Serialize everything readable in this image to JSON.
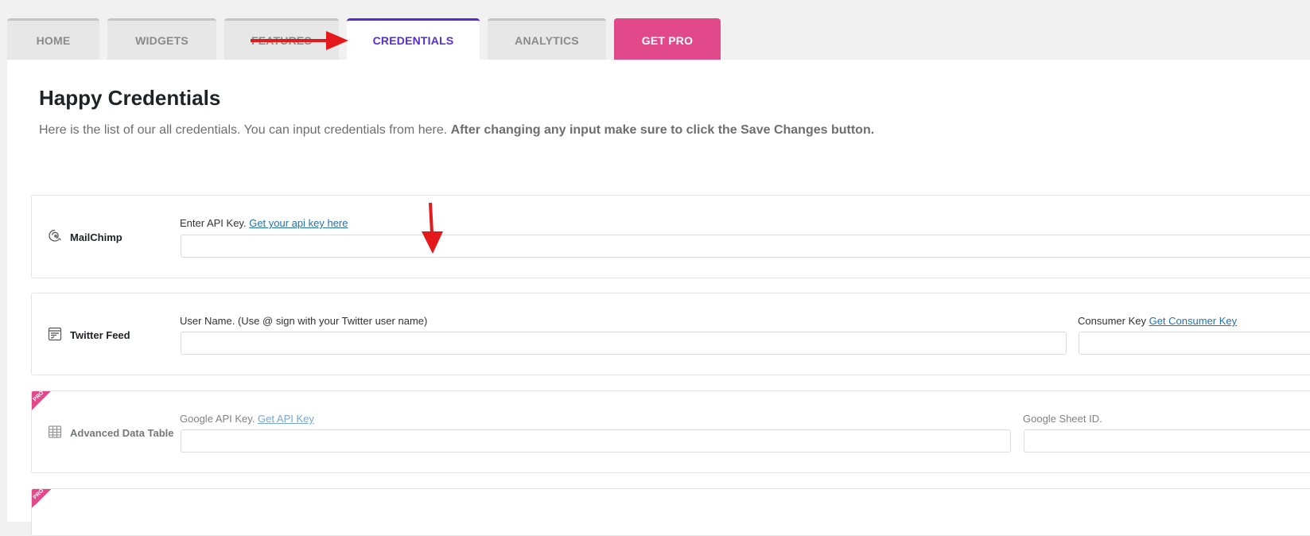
{
  "tabs": [
    {
      "label": "HOME"
    },
    {
      "label": "WIDGETS"
    },
    {
      "label": "FEATURES"
    },
    {
      "label": "CREDENTIALS",
      "active": true
    },
    {
      "label": "ANALYTICS"
    },
    {
      "label": "GET PRO"
    }
  ],
  "colors": {
    "accent": "#562dd4",
    "pro": "#e2498a",
    "link": "#2271b1",
    "annotation": "#e5191b"
  },
  "page": {
    "title": "Happy Credentials",
    "description": "Here is the list of our all credentials. You can input credentials from here. ",
    "description_bold": "After changing any input make sure to click the Save Changes button."
  },
  "credentials": [
    {
      "name": "MailChimp",
      "icon": "mailchimp-icon",
      "fields": [
        {
          "label": "Enter API Key. ",
          "link": "Get your api key here",
          "value": ""
        }
      ]
    },
    {
      "name": "Twitter Feed",
      "icon": "twitter-feed-icon",
      "fields": [
        {
          "label": "User Name. (Use @ sign with your Twitter user name)",
          "value": ""
        },
        {
          "label": "Consumer Key ",
          "link": "Get Consumer Key",
          "value": ""
        }
      ]
    },
    {
      "name": "Advanced Data Table",
      "icon": "data-table-icon",
      "pro_badge": "PRO",
      "fields": [
        {
          "label": "Google API Key. ",
          "link": "Get API Key",
          "value": ""
        },
        {
          "label": "Google Sheet ID.",
          "value": ""
        }
      ]
    },
    {
      "pro_badge": "PRO"
    }
  ]
}
